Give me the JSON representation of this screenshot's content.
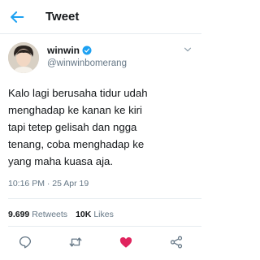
{
  "header": {
    "title": "Tweet",
    "back_icon": "arrow-left-icon",
    "accent": "#1da1f2"
  },
  "author": {
    "display_name": "winwin",
    "handle": "@winwinbomerang",
    "verified": true
  },
  "tweet": {
    "lines": [
      "Kalo lagi berusaha tidur udah",
      "menghadap ke kanan ke kiri",
      "tapi tetep gelisah dan ngga",
      "tenang, coba menghadap ke",
      "yang maha kuasa aja."
    ],
    "timestamp": "10:16 PM · 25 Apr 19"
  },
  "stats": {
    "retweets_count": "9.699",
    "retweets_label": "Retweets",
    "likes_count": "10K",
    "likes_label": "Likes"
  },
  "actions": {
    "reply_icon": "reply-icon",
    "retweet_icon": "retweet-icon",
    "like_icon": "heart-icon",
    "like_color": "#e0245e",
    "share_icon": "share-icon"
  }
}
